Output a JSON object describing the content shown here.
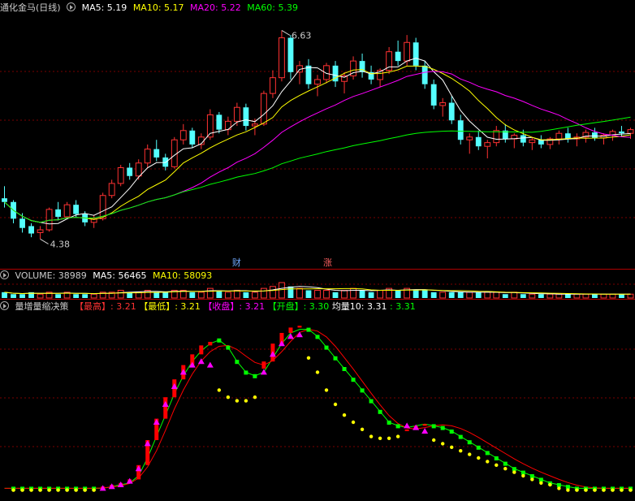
{
  "colors": {
    "bg": "#000000",
    "grid": "#7a0000",
    "up": "#ff3232",
    "down": "#54ffff",
    "ma5": "#ffffff",
    "ma10": "#ffff00",
    "ma20": "#ff00ff",
    "ma60": "#00ff00",
    "vol_ma5": "#ffffff",
    "vol_ma10": "#ffff00",
    "ind_high": "#ff0000",
    "ind_low": "#ffff00",
    "ind_close": "#ff00ff",
    "ind_open": "#00ff00",
    "ind_avg": "#ffffff"
  },
  "panel_main": {
    "title": "通化金马(日线)",
    "ma5_label": "MA5: 5.19",
    "ma10_label": "MA10: 5.17",
    "ma20_label": "MA20: 5.22",
    "ma60_label": "MA60: 5.39",
    "high_annot": "6.63",
    "low_annot": "4.38",
    "marker_cai": "财",
    "marker_zhang": "涨"
  },
  "panel_volume": {
    "title": "VOLUME: 38989",
    "ma5_label": "MA5: 56465",
    "ma10_label": "MA10: 58093"
  },
  "panel_ind": {
    "title": "量增量缩决策",
    "high_label": "【最高】",
    "high_value": ": 3.21",
    "low_label": "【最低】",
    "low_value": ": 3.21",
    "close_label": "【收盘】",
    "close_value": ": 3.21",
    "open_label": "【开盘】",
    "open_value": ": 3.30",
    "avg_label": "均量10: 3.31",
    "avg_value": ": 3.31"
  },
  "chart_data": [
    {
      "type": "candlestick",
      "ylim": [
        4.2,
        6.8
      ],
      "ohlc": [
        [
          4.82,
          4.95,
          4.72,
          4.78
        ],
        [
          4.78,
          4.8,
          4.55,
          4.6
        ],
        [
          4.6,
          4.66,
          4.45,
          4.5
        ],
        [
          4.52,
          4.55,
          4.4,
          4.44
        ],
        [
          4.45,
          4.52,
          4.38,
          4.48
        ],
        [
          4.48,
          4.72,
          4.46,
          4.7
        ],
        [
          4.7,
          4.78,
          4.58,
          4.62
        ],
        [
          4.62,
          4.78,
          4.6,
          4.75
        ],
        [
          4.75,
          4.8,
          4.62,
          4.65
        ],
        [
          4.65,
          4.68,
          4.52,
          4.56
        ],
        [
          4.56,
          4.64,
          4.5,
          4.6
        ],
        [
          4.6,
          4.88,
          4.58,
          4.85
        ],
        [
          4.85,
          5.02,
          4.82,
          4.98
        ],
        [
          4.98,
          5.18,
          4.95,
          5.15
        ],
        [
          5.15,
          5.2,
          5.02,
          5.06
        ],
        [
          5.06,
          5.24,
          5.02,
          5.2
        ],
        [
          5.2,
          5.4,
          5.15,
          5.35
        ],
        [
          5.35,
          5.45,
          5.22,
          5.26
        ],
        [
          5.26,
          5.3,
          5.12,
          5.16
        ],
        [
          5.16,
          5.48,
          5.14,
          5.45
        ],
        [
          5.45,
          5.62,
          5.4,
          5.55
        ],
        [
          5.55,
          5.58,
          5.36,
          5.4
        ],
        [
          5.4,
          5.52,
          5.35,
          5.48
        ],
        [
          5.48,
          5.78,
          5.45,
          5.72
        ],
        [
          5.72,
          5.75,
          5.52,
          5.56
        ],
        [
          5.56,
          5.7,
          5.5,
          5.65
        ],
        [
          5.65,
          5.85,
          5.6,
          5.8
        ],
        [
          5.8,
          5.84,
          5.55,
          5.6
        ],
        [
          5.6,
          5.68,
          5.5,
          5.62
        ],
        [
          5.62,
          5.98,
          5.6,
          5.95
        ],
        [
          5.95,
          6.2,
          5.9,
          6.12
        ],
        [
          6.12,
          6.63,
          6.08,
          6.55
        ],
        [
          6.55,
          6.58,
          6.1,
          6.18
        ],
        [
          6.18,
          6.3,
          6.05,
          6.25
        ],
        [
          6.25,
          6.32,
          6.0,
          6.05
        ],
        [
          6.05,
          6.15,
          5.92,
          6.1
        ],
        [
          6.1,
          6.28,
          6.06,
          6.25
        ],
        [
          6.25,
          6.3,
          6.02,
          6.08
        ],
        [
          6.08,
          6.18,
          5.95,
          6.14
        ],
        [
          6.14,
          6.35,
          6.1,
          6.3
        ],
        [
          6.3,
          6.38,
          6.12,
          6.18
        ],
        [
          6.18,
          6.25,
          6.05,
          6.1
        ],
        [
          6.1,
          6.22,
          6.02,
          6.2
        ],
        [
          6.2,
          6.45,
          6.16,
          6.4
        ],
        [
          6.4,
          6.52,
          6.25,
          6.3
        ],
        [
          6.3,
          6.58,
          6.25,
          6.5
        ],
        [
          6.5,
          6.55,
          6.2,
          6.25
        ],
        [
          6.25,
          6.3,
          6.0,
          6.05
        ],
        [
          6.05,
          6.1,
          5.78,
          5.82
        ],
        [
          5.82,
          5.9,
          5.7,
          5.85
        ],
        [
          5.85,
          5.92,
          5.62,
          5.66
        ],
        [
          5.66,
          5.72,
          5.4,
          5.45
        ],
        [
          5.45,
          5.52,
          5.3,
          5.48
        ],
        [
          5.48,
          5.55,
          5.34,
          5.38
        ],
        [
          5.38,
          5.45,
          5.25,
          5.42
        ],
        [
          5.42,
          5.6,
          5.38,
          5.55
        ],
        [
          5.55,
          5.62,
          5.42,
          5.46
        ],
        [
          5.46,
          5.52,
          5.36,
          5.5
        ],
        [
          5.5,
          5.56,
          5.38,
          5.42
        ],
        [
          5.42,
          5.48,
          5.34,
          5.45
        ],
        [
          5.45,
          5.5,
          5.36,
          5.4
        ],
        [
          5.4,
          5.48,
          5.35,
          5.46
        ],
        [
          5.46,
          5.55,
          5.4,
          5.52
        ],
        [
          5.52,
          5.58,
          5.42,
          5.46
        ],
        [
          5.46,
          5.52,
          5.38,
          5.48
        ],
        [
          5.48,
          5.56,
          5.42,
          5.53
        ],
        [
          5.53,
          5.58,
          5.44,
          5.47
        ],
        [
          5.47,
          5.52,
          5.4,
          5.5
        ],
        [
          5.5,
          5.56,
          5.44,
          5.54
        ],
        [
          5.54,
          5.6,
          5.48,
          5.52
        ],
        [
          5.52,
          5.58,
          5.46,
          5.56
        ]
      ]
    },
    {
      "type": "bar",
      "values": [
        3,
        2,
        2,
        3,
        2,
        3,
        2,
        3,
        2,
        2,
        2,
        3,
        3,
        4,
        3,
        3,
        4,
        3,
        3,
        4,
        4,
        3,
        3,
        5,
        4,
        3,
        4,
        3,
        3,
        5,
        6,
        8,
        6,
        5,
        4,
        4,
        4,
        3,
        4,
        5,
        4,
        3,
        4,
        5,
        4,
        5,
        4,
        4,
        3,
        3,
        3,
        3,
        3,
        3,
        3,
        3,
        2,
        3,
        2,
        2,
        2,
        2,
        2,
        2,
        2,
        2,
        2,
        2,
        2,
        2,
        2
      ]
    },
    {
      "type": "indicator",
      "ylim": [
        0,
        10
      ],
      "high": [
        0.3,
        0.3,
        0.3,
        0.3,
        0.3,
        0.3,
        0.3,
        0.3,
        0.3,
        0.3,
        0.3,
        0.4,
        0.5,
        0.6,
        0.8,
        1.6,
        3.0,
        4.2,
        5.4,
        6.4,
        7.2,
        7.8,
        8.3,
        8.5,
        8.4,
        8.0,
        7.4,
        7.0,
        7.0,
        7.4,
        8.4,
        9.0,
        9.3,
        9.4,
        9.1,
        8.6,
        8.0,
        7.3,
        6.6,
        6.0,
        5.3,
        4.6,
        4.0,
        3.6,
        3.5,
        3.6,
        3.8,
        3.9,
        3.9,
        3.8,
        3.6,
        3.3,
        3.0,
        2.7,
        2.4,
        2.1,
        1.8,
        1.5,
        1.3,
        1.1,
        0.9,
        0.7,
        0.5,
        0.4,
        0.3,
        0.3,
        0.3,
        0.3,
        0.3,
        0.3,
        0.3
      ],
      "low": [
        0.2,
        0.2,
        0.2,
        0.2,
        0.2,
        0.2,
        0.2,
        0.2,
        0.2,
        0.2,
        0.2,
        0.2,
        0.3,
        0.4,
        0.6,
        1.2,
        2.4,
        3.6,
        4.8,
        5.8,
        6.6,
        7.0,
        7.0,
        6.6,
        5.8,
        5.4,
        5.2,
        5.2,
        5.4,
        6.0,
        7.0,
        7.6,
        8.0,
        8.2,
        7.6,
        6.8,
        5.8,
        5.0,
        4.4,
        4.0,
        3.6,
        3.2,
        3.1,
        3.1,
        3.2,
        3.3,
        3.2,
        3.1,
        3.0,
        2.8,
        2.6,
        2.4,
        2.2,
        2.0,
        1.8,
        1.6,
        1.4,
        1.2,
        1.0,
        0.8,
        0.6,
        0.5,
        0.3,
        0.2,
        0.2,
        0.2,
        0.2,
        0.2,
        0.2,
        0.2,
        0.2
      ],
      "close": [
        0.2,
        0.2,
        0.2,
        0.2,
        0.2,
        0.2,
        0.2,
        0.2,
        0.2,
        0.2,
        0.2,
        0.3,
        0.4,
        0.5,
        0.7,
        1.4,
        2.8,
        4.0,
        5.0,
        6.0,
        6.8,
        7.2,
        7.4,
        7.2,
        6.6,
        6.0,
        5.6,
        5.6,
        6.0,
        6.8,
        7.8,
        8.4,
        8.8,
        8.9,
        8.4,
        7.6,
        6.8,
        6.0,
        5.2,
        4.5,
        4.0,
        3.6,
        3.4,
        3.4,
        3.6,
        3.8,
        3.7,
        3.5,
        3.3,
        3.1,
        2.9,
        2.7,
        2.5,
        2.3,
        2.1,
        1.9,
        1.6,
        1.4,
        1.2,
        1.0,
        0.8,
        0.6,
        0.4,
        0.3,
        0.2,
        0.3,
        0.4,
        0.4,
        0.4,
        0.4,
        0.4
      ],
      "open": [
        0.3,
        0.3,
        0.3,
        0.3,
        0.3,
        0.3,
        0.3,
        0.3,
        0.3,
        0.3,
        0.3,
        0.3,
        0.4,
        0.5,
        0.6,
        1.0,
        2.0,
        3.2,
        4.4,
        5.6,
        6.6,
        7.4,
        8.0,
        8.4,
        8.6,
        8.2,
        7.4,
        6.8,
        6.6,
        6.8,
        7.6,
        8.4,
        9.0,
        9.2,
        9.2,
        8.8,
        8.2,
        7.6,
        7.0,
        6.4,
        5.8,
        5.2,
        4.6,
        4.0,
        3.8,
        3.7,
        3.8,
        3.9,
        3.8,
        3.7,
        3.5,
        3.2,
        2.9,
        2.6,
        2.3,
        2.0,
        1.7,
        1.4,
        1.2,
        1.0,
        0.8,
        0.6,
        0.5,
        0.4,
        0.3,
        0.3,
        0.3,
        0.3,
        0.3,
        0.3,
        0.3
      ]
    }
  ]
}
